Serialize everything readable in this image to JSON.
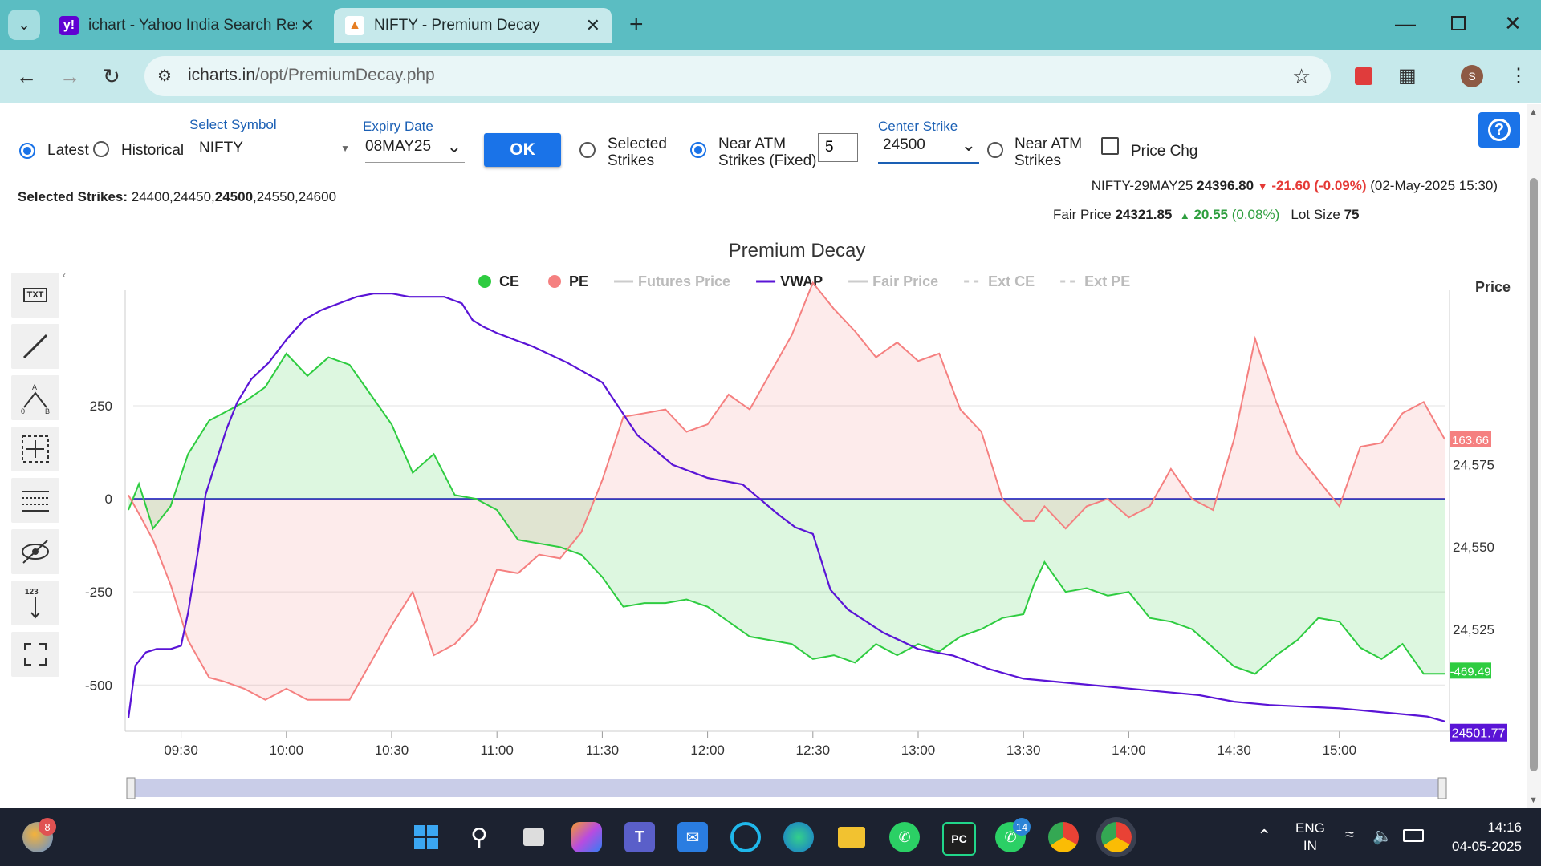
{
  "browser": {
    "tabs": [
      {
        "title": "ichart - Yahoo India Search Resu",
        "favicon": "y!",
        "active": false
      },
      {
        "title": "NIFTY - Premium Decay",
        "favicon": "chart-icon",
        "active": true
      }
    ],
    "new_tab": "+",
    "url_domain": "icharts.in",
    "url_path": "/opt/PremiumDecay.php",
    "profile_initial": "S"
  },
  "controls": {
    "latest_label": "Latest",
    "historical_label": "Historical",
    "select_symbol_label": "Select Symbol",
    "symbol_value": "NIFTY",
    "expiry_label": "Expiry Date",
    "expiry_value": "08MAY25",
    "ok_label": "OK",
    "selected_strikes_line1": "Selected",
    "selected_strikes_line2": "Strikes",
    "near_atm_fixed_line1": "Near ATM",
    "near_atm_fixed_line2": "Strikes (Fixed)",
    "atm_count": "5",
    "center_strike_label": "Center Strike",
    "center_strike_value": "24500",
    "near_atm_line1": "Near ATM",
    "near_atm_line2": "Strikes",
    "price_chg_label": "Price Chg",
    "selected_strikes_title": "Selected Strikes:",
    "strikes_before": "24400,24450,",
    "strike_center": "24500",
    "strikes_after": ",24550,24600"
  },
  "quote": {
    "symbol": "NIFTY-29MAY25",
    "price": "24396.80",
    "change": "-21.60",
    "change_pct": "(-0.09%)",
    "datetime": "(02-May-2025 15:30)",
    "fair_label": "Fair Price",
    "fair_price": "24321.85",
    "fair_change": "20.55",
    "fair_change_pct": "(0.08%)",
    "lot_label": "Lot Size",
    "lot_size": "75"
  },
  "chart_data": {
    "type": "line",
    "title": "Premium Decay",
    "legend": [
      {
        "name": "CE",
        "color": "#2ecc40",
        "style": "dot",
        "active": true
      },
      {
        "name": "PE",
        "color": "#f58080",
        "style": "dot",
        "active": true
      },
      {
        "name": "Futures Price",
        "color": "#cccccc",
        "style": "line",
        "active": false
      },
      {
        "name": "VWAP",
        "color": "#5a14d6",
        "style": "line",
        "active": true
      },
      {
        "name": "Fair Price",
        "color": "#cccccc",
        "style": "line",
        "active": false
      },
      {
        "name": "Ext CE",
        "color": "#cccccc",
        "style": "dash",
        "active": false
      },
      {
        "name": "Ext PE",
        "color": "#cccccc",
        "style": "dash",
        "active": false
      }
    ],
    "left_axis": {
      "ticks": [
        250,
        0,
        -250,
        -500
      ],
      "ylim": [
        -620,
        560
      ]
    },
    "right_axis": {
      "label": "Price",
      "ticks": [
        "24,575",
        "24,550",
        "24,525"
      ],
      "ylim": [
        24494.5,
        24628
      ]
    },
    "x_axis": {
      "ticks": [
        "09:30",
        "10:00",
        "10:30",
        "11:00",
        "11:30",
        "12:00",
        "12:30",
        "13:00",
        "13:30",
        "14:00",
        "14:30",
        "15:00"
      ],
      "tick_minutes": [
        570,
        600,
        630,
        660,
        690,
        720,
        750,
        780,
        810,
        840,
        870,
        900
      ],
      "xlim": [
        555,
        930
      ]
    },
    "series": [
      {
        "name": "CE",
        "color": "#2ecc40",
        "x": [
          555,
          558,
          562,
          567,
          572,
          578,
          582,
          588,
          594,
          600,
          606,
          612,
          618,
          624,
          630,
          636,
          642,
          648,
          654,
          660,
          666,
          672,
          678,
          684,
          690,
          696,
          702,
          708,
          714,
          720,
          726,
          732,
          738,
          744,
          750,
          756,
          762,
          768,
          774,
          780,
          786,
          792,
          798,
          804,
          810,
          813,
          816,
          822,
          828,
          834,
          840,
          846,
          852,
          858,
          864,
          870,
          876,
          882,
          888,
          894,
          900,
          906,
          912,
          918,
          924,
          930
        ],
        "y": [
          -30,
          40,
          -80,
          -20,
          120,
          210,
          230,
          260,
          300,
          390,
          330,
          380,
          360,
          280,
          200,
          70,
          120,
          10,
          0,
          -30,
          -110,
          -120,
          -130,
          -150,
          -210,
          -290,
          -280,
          -280,
          -270,
          -290,
          -330,
          -370,
          -380,
          -390,
          -430,
          -420,
          -440,
          -390,
          -420,
          -390,
          -410,
          -370,
          -350,
          -320,
          -310,
          -230,
          -170,
          -250,
          -240,
          -260,
          -250,
          -320,
          -330,
          -350,
          -400,
          -450,
          -470,
          -420,
          -380,
          -320,
          -330,
          -400,
          -430,
          -390,
          -470,
          -470
        ]
      },
      {
        "name": "PE",
        "color": "#f58080",
        "x": [
          555,
          558,
          562,
          567,
          572,
          578,
          582,
          588,
          594,
          600,
          606,
          612,
          618,
          624,
          630,
          636,
          642,
          648,
          654,
          660,
          666,
          672,
          678,
          684,
          690,
          696,
          702,
          708,
          714,
          720,
          726,
          732,
          738,
          744,
          750,
          756,
          762,
          768,
          774,
          780,
          786,
          792,
          798,
          804,
          810,
          813,
          816,
          822,
          828,
          834,
          840,
          846,
          852,
          858,
          864,
          870,
          876,
          882,
          888,
          894,
          900,
          906,
          912,
          918,
          924,
          930
        ],
        "y": [
          10,
          -40,
          -110,
          -230,
          -380,
          -480,
          -490,
          -510,
          -540,
          -510,
          -540,
          -540,
          -540,
          -440,
          -340,
          -250,
          -420,
          -390,
          -330,
          -190,
          -200,
          -150,
          -160,
          -90,
          50,
          220,
          230,
          240,
          180,
          200,
          280,
          240,
          340,
          440,
          580,
          510,
          450,
          380,
          420,
          370,
          390,
          240,
          180,
          0,
          -60,
          -60,
          -20,
          -80,
          -20,
          0,
          -50,
          -20,
          80,
          0,
          -30,
          160,
          430,
          260,
          120,
          50,
          -20,
          140,
          150,
          230,
          260,
          160
        ]
      },
      {
        "name": "VWAP",
        "color": "#5a14d6",
        "axis": "right",
        "x": [
          555,
          557,
          560,
          563,
          567,
          570,
          572,
          575,
          577,
          580,
          583,
          586,
          590,
          595,
          600,
          605,
          610,
          615,
          620,
          625,
          630,
          635,
          640,
          645,
          650,
          653,
          656,
          660,
          665,
          670,
          680,
          690,
          700,
          710,
          720,
          730,
          740,
          745,
          750,
          755,
          760,
          770,
          780,
          790,
          800,
          810,
          820,
          830,
          840,
          850,
          860,
          870,
          880,
          890,
          900,
          910,
          920,
          925,
          930
        ],
        "y": [
          24498,
          24514,
          24518,
          24519,
          24519,
          24520,
          24530,
          24550,
          24566,
          24576,
          24586,
          24594,
          24601,
          24606,
          24613,
          24619,
          24622,
          24624,
          24626,
          24627,
          24627,
          24626,
          24626,
          24626,
          24624,
          24619,
          24617,
          24615,
          24613,
          24611,
          24606,
          24600,
          24584,
          24575,
          24571,
          24569,
          24560,
          24556,
          24554,
          24537,
          24531,
          24524,
          24519,
          24517,
          24513,
          24510,
          24509,
          24508,
          24507,
          24506,
          24505,
          24503,
          24502,
          24501.5,
          24501,
          24500,
          24499,
          24498.5,
          24497
        ]
      }
    ],
    "last_values": {
      "PE": "163.66",
      "CE": "-469.49",
      "VWAP": "24501.77"
    }
  },
  "taskbar": {
    "weather_badge": "8",
    "whatsapp_badge": "14",
    "lang_line1": "ENG",
    "lang_line2": "IN",
    "time": "14:16",
    "date": "04-05-2025"
  }
}
